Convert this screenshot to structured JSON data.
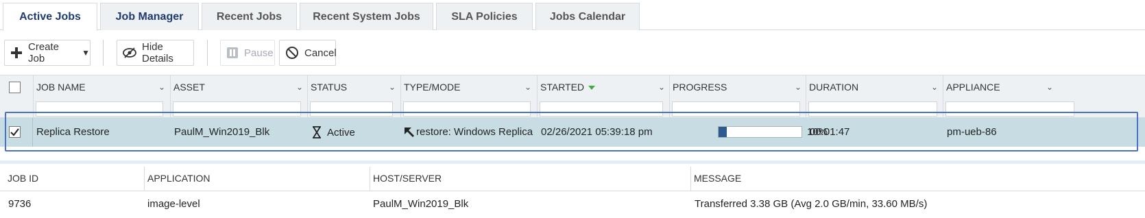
{
  "tabs": [
    {
      "label": "Active Jobs"
    },
    {
      "label": "Job Manager"
    },
    {
      "label": "Recent Jobs"
    },
    {
      "label": "Recent System Jobs"
    },
    {
      "label": "SLA Policies"
    },
    {
      "label": "Jobs Calendar"
    }
  ],
  "toolbar": {
    "create_job": "Create Job",
    "hide_details": "Hide Details",
    "pause": "Pause",
    "cancel": "Cancel"
  },
  "columns": [
    {
      "label": "JOB NAME"
    },
    {
      "label": "ASSET"
    },
    {
      "label": "STATUS"
    },
    {
      "label": "TYPE/MODE"
    },
    {
      "label": "STARTED"
    },
    {
      "label": "PROGRESS"
    },
    {
      "label": "DURATION"
    },
    {
      "label": "APPLIANCE"
    }
  ],
  "row": {
    "job_name": "Replica Restore",
    "asset": "PaulM_Win2019_Blk",
    "status": "Active",
    "type_mode": "restore: Windows Replica",
    "started": "02/26/2021 05:39:18 pm",
    "progress_percent": 10,
    "progress_label": "10%",
    "duration": "00:01:47",
    "appliance": "pm-ueb-86",
    "selected": true
  },
  "details": {
    "headers": [
      "JOB ID",
      "APPLICATION",
      "HOST/SERVER",
      "MESSAGE"
    ],
    "values": [
      "9736",
      "image-level",
      "PaulM_Win2019_Blk",
      "Transferred 3.38 GB (Avg 2.0 GB/min, 33.60 MB/s)"
    ]
  },
  "icons": {
    "create_job": "plus-icon",
    "hide_details": "eye-slash-icon",
    "pause": "pause-icon",
    "cancel": "cancel-icon",
    "status": "hourglass-icon",
    "type_mode": "restore-arrow-icon"
  },
  "colors": {
    "active_tab_text": "#1f3b6e",
    "selected_row": "#c8dde3",
    "row_outline": "#4a72c4",
    "progress_fill": "#2e5a8f",
    "sort_indicator": "#3cae3c"
  }
}
